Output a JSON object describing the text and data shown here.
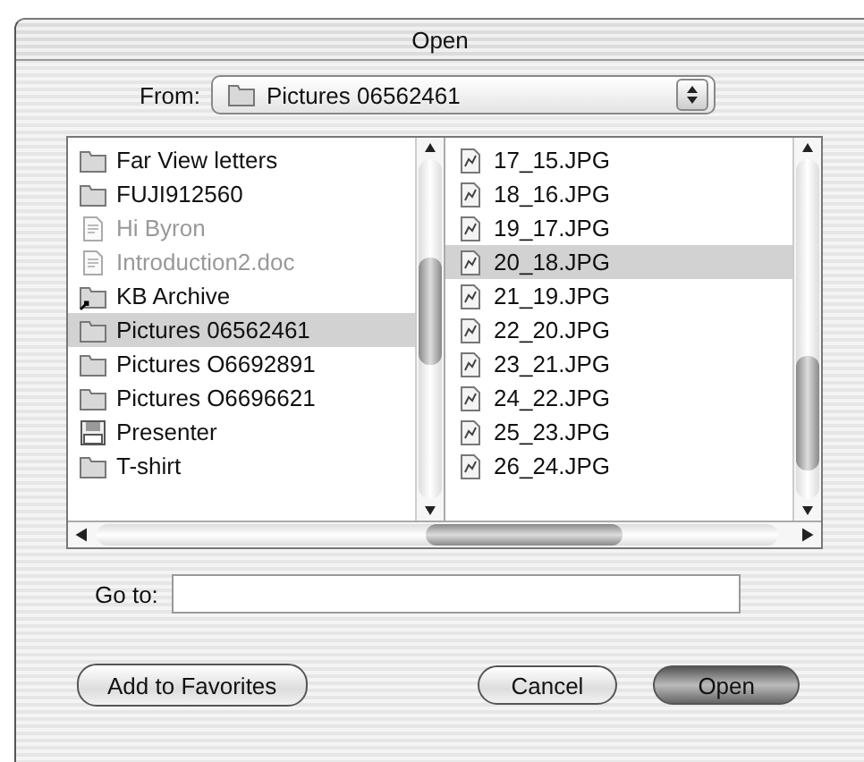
{
  "window": {
    "title": "Open"
  },
  "from": {
    "label": "From:",
    "value": "Pictures 06562461"
  },
  "left_column": [
    {
      "name": "Far View letters",
      "kind": "folder",
      "disabled": false,
      "selected": false
    },
    {
      "name": "FUJI912560",
      "kind": "folder",
      "disabled": false,
      "selected": false
    },
    {
      "name": "Hi Byron",
      "kind": "document",
      "disabled": true,
      "selected": false
    },
    {
      "name": "Introduction2.doc",
      "kind": "document",
      "disabled": true,
      "selected": false
    },
    {
      "name": "KB Archive",
      "kind": "alias",
      "disabled": false,
      "selected": false
    },
    {
      "name": "Pictures 06562461",
      "kind": "folder",
      "disabled": false,
      "selected": true
    },
    {
      "name": "Pictures O6692891",
      "kind": "folder",
      "disabled": false,
      "selected": false
    },
    {
      "name": "Pictures O6696621",
      "kind": "folder",
      "disabled": false,
      "selected": false
    },
    {
      "name": "Presenter",
      "kind": "app",
      "disabled": false,
      "selected": false
    },
    {
      "name": "T-shirt",
      "kind": "folder",
      "disabled": false,
      "selected": false
    }
  ],
  "right_column": [
    {
      "name": "17_15.JPG",
      "kind": "image",
      "disabled": false,
      "selected": false
    },
    {
      "name": "18_16.JPG",
      "kind": "image",
      "disabled": false,
      "selected": false
    },
    {
      "name": "19_17.JPG",
      "kind": "image",
      "disabled": false,
      "selected": false
    },
    {
      "name": "20_18.JPG",
      "kind": "image",
      "disabled": false,
      "selected": true
    },
    {
      "name": "21_19.JPG",
      "kind": "image",
      "disabled": false,
      "selected": false
    },
    {
      "name": "22_20.JPG",
      "kind": "image",
      "disabled": false,
      "selected": false
    },
    {
      "name": "23_21.JPG",
      "kind": "image",
      "disabled": false,
      "selected": false
    },
    {
      "name": "24_22.JPG",
      "kind": "image",
      "disabled": false,
      "selected": false
    },
    {
      "name": "25_23.JPG",
      "kind": "image",
      "disabled": false,
      "selected": false
    },
    {
      "name": "26_24.JPG",
      "kind": "image",
      "disabled": false,
      "selected": false
    }
  ],
  "go_to": {
    "label": "Go to:"
  },
  "buttons": [
    {
      "label": "Add to Favorites",
      "kind": "secondary"
    },
    {
      "label": "Cancel",
      "kind": "normal"
    },
    {
      "label": "Open",
      "kind": "default"
    }
  ]
}
